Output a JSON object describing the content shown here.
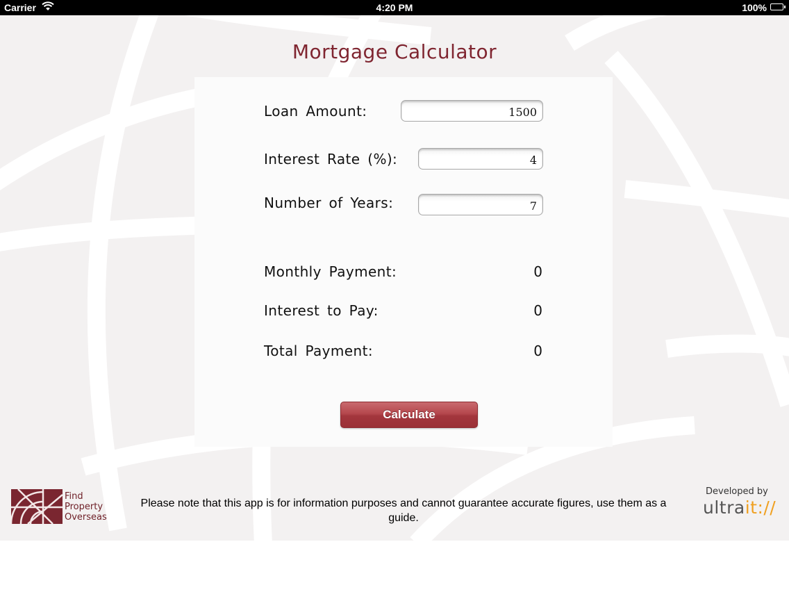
{
  "status_bar": {
    "carrier": "Carrier",
    "time": "4:20 PM",
    "battery": "100%"
  },
  "app": {
    "title": "Mortgage Calculator",
    "accent_color": "#7f2530",
    "button_color": "#b5474d"
  },
  "inputs": {
    "loan_amount": {
      "label": "Loan Amount:",
      "value": "1500"
    },
    "interest_rate": {
      "label": "Interest Rate (%):",
      "value": "4"
    },
    "years": {
      "label": "Number of Years:",
      "value": "7"
    }
  },
  "results": {
    "monthly_payment": {
      "label": "Monthly Payment:",
      "value": "0"
    },
    "interest_to_pay": {
      "label": "Interest to Pay:",
      "value": "0"
    },
    "total_payment": {
      "label": "Total Payment:",
      "value": "0"
    }
  },
  "actions": {
    "calculate_label": "Calculate"
  },
  "footer": {
    "disclaimer": "Please note that this app is for information purposes and cannot guarantee accurate figures, use them as a guide.",
    "logo_line1": "Find",
    "logo_line2": "Property",
    "logo_line3": "Overseas",
    "developed_by": "Developed by",
    "developer_brand_part1": "ultra",
    "developer_brand_part2": "it://"
  }
}
